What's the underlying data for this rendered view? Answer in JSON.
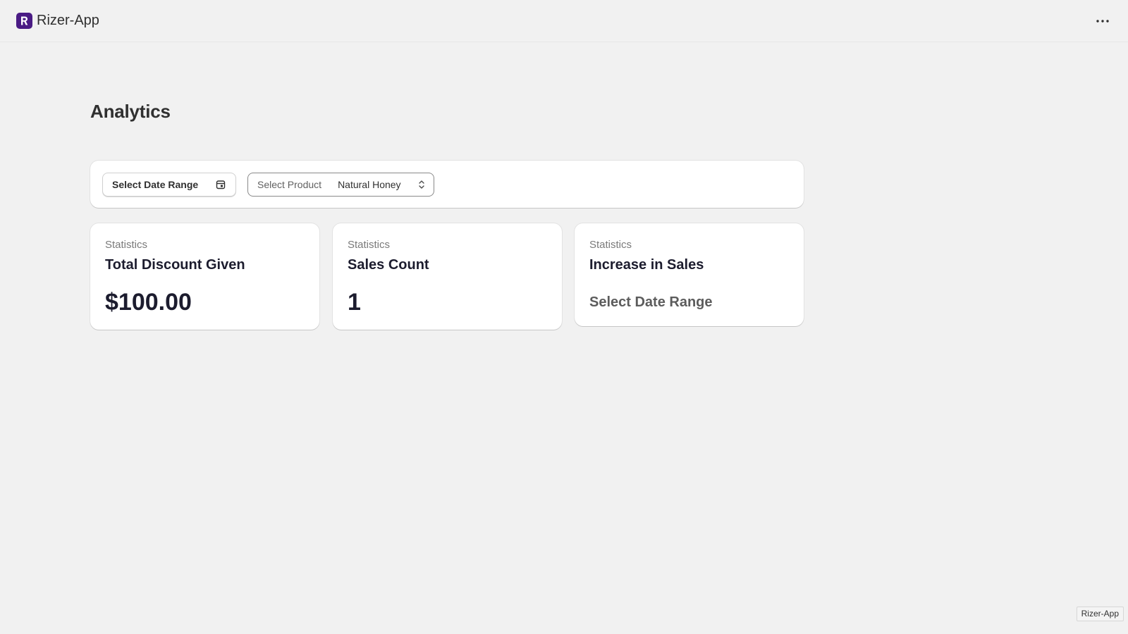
{
  "app": {
    "name": "Rizer-App",
    "logo_letter": "R",
    "brand_color": "#4a1b84"
  },
  "header": {
    "more_icon": "more-horizontal-icon"
  },
  "page": {
    "title": "Analytics"
  },
  "filters": {
    "date_range_label": "Select Date Range",
    "date_icon": "calendar-icon",
    "product_label": "Select Product",
    "product_value": "Natural Honey",
    "product_icon": "chevron-up-down-icon"
  },
  "stats": [
    {
      "kicker": "Statistics",
      "title": "Total Discount Given",
      "value": "$100.00"
    },
    {
      "kicker": "Statistics",
      "title": "Sales Count",
      "value": "1"
    },
    {
      "kicker": "Statistics",
      "title": "Increase in Sales",
      "placeholder": "Select Date Range"
    }
  ],
  "corner_badge": "Rizer-App"
}
